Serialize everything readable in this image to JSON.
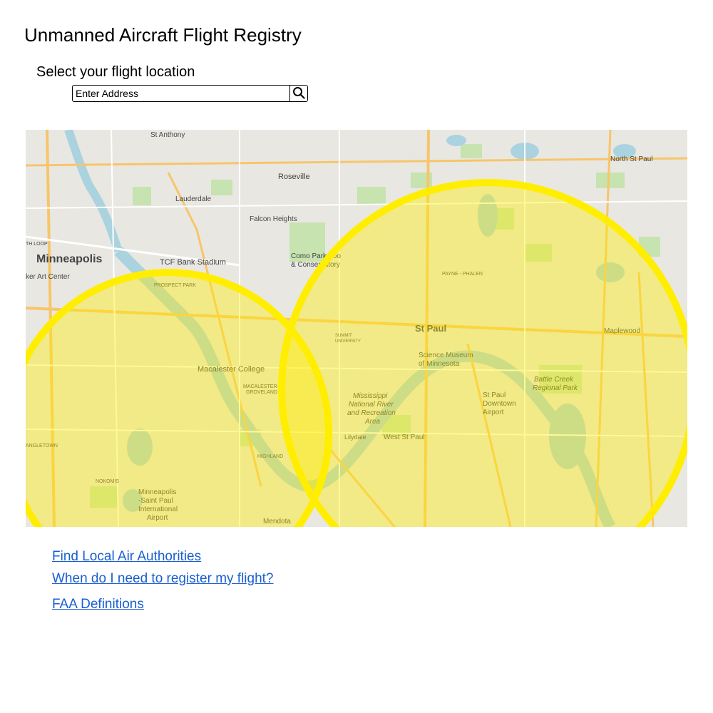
{
  "page": {
    "title": "Unmanned Aircraft Flight Registry",
    "location_label": "Select your flight location"
  },
  "search": {
    "value": "",
    "placeholder": "Enter Address",
    "button_icon": "search-icon"
  },
  "map": {
    "overlay_color": "#ffee00",
    "places": {
      "minneapolis": "Minneapolis",
      "st_paul": "St Paul",
      "roseville": "Roseville",
      "lauderdale": "Lauderdale",
      "falcon_heights": "Falcon Heights",
      "st_anthony": "St Anthony",
      "como_park_1": "Como Park Zoo",
      "como_park_2": "& Conservatory",
      "tcf": "TCF Bank Stadium",
      "art_center": "ker Art Center",
      "macalester": "Macalester College",
      "macalester_groveland_1": "MACALESTER-",
      "macalester_groveland_2": "GROVELAND",
      "science_1": "Science Museum",
      "science_2": "of Minnesota",
      "airport_1": "St Paul",
      "airport_2": "Downtown",
      "airport_3": "Airport",
      "msp_1": "Minneapolis",
      "msp_2": "-Saint Paul",
      "msp_3": "International",
      "msp_4": "Airport",
      "maplewood": "Maplewood",
      "west_st_paul": "West St Paul",
      "lilydale": "Lilydale",
      "mendota": "Mendota",
      "battle_creek_1": "Battle Creek",
      "battle_creek_2": "Regional Park",
      "river_area_1": "Mississippi",
      "river_area_2": "National River",
      "river_area_3": "and Recreation",
      "river_area_4": "Area",
      "north_st_paul": "North St Paul",
      "payne_phalen": "PAYNE - PHALEN",
      "highland": "HIGHLAND",
      "summit_university_1": "SUMMIT",
      "summit_university_2": "UNIVERSITY",
      "prospect_park": "PROSPECT PARK",
      "nokomis": "NOKOMIS",
      "th_loop": "TH LOOP",
      "angletown": "ANGLETOWN"
    }
  },
  "links": {
    "local_authorities": "Find Local Air Authorities",
    "when_register": "When do I need to register my flight?",
    "faa_definitions": "FAA Definitions"
  }
}
